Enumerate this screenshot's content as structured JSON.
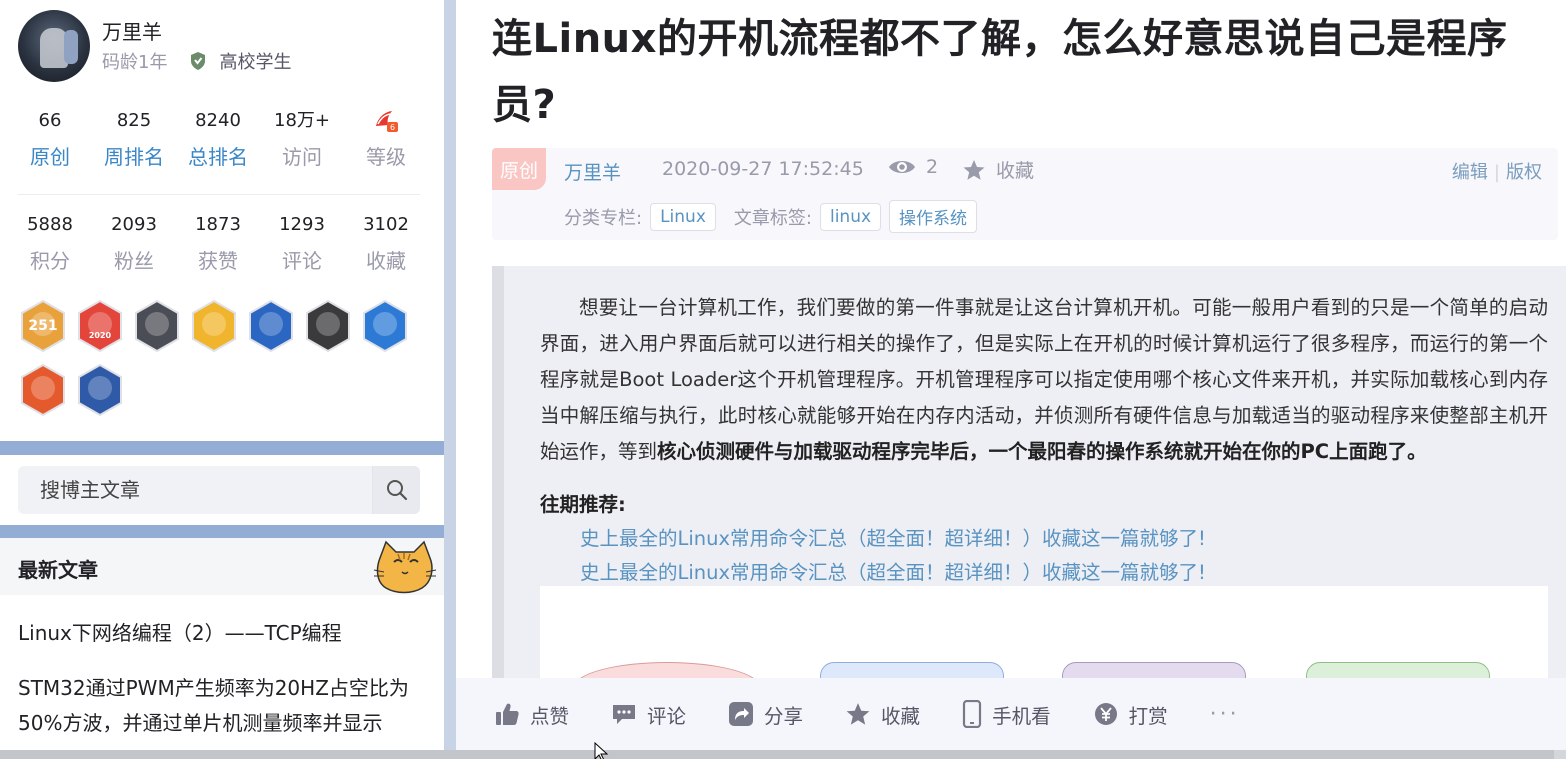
{
  "profile": {
    "name": "万里羊",
    "code_age": "码龄1年",
    "identity": "高校学生",
    "stats1": [
      {
        "value": "66",
        "label": "原创"
      },
      {
        "value": "825",
        "label": "周排名"
      },
      {
        "value": "8240",
        "label": "总排名"
      },
      {
        "value": "18万+",
        "label": "访问"
      },
      {
        "value": "",
        "label": "等级"
      }
    ],
    "stats2": [
      {
        "value": "5888",
        "label": "积分"
      },
      {
        "value": "2093",
        "label": "粉丝"
      },
      {
        "value": "1873",
        "label": "获赞"
      },
      {
        "value": "1293",
        "label": "评论"
      },
      {
        "value": "3102",
        "label": "收藏"
      }
    ],
    "badges": [
      {
        "text": "251",
        "color": "#e9a23b"
      },
      {
        "text": "2020",
        "color": "#e3453a"
      },
      {
        "text": "",
        "color": "#4a4d55"
      },
      {
        "text": "",
        "color": "#f0b42d"
      },
      {
        "text": "",
        "color": "#2a66c2"
      },
      {
        "text": "",
        "color": "#3a3a3c"
      },
      {
        "text": "",
        "color": "#2d7ad6"
      },
      {
        "text": "",
        "color": "#e55a2c"
      },
      {
        "text": "",
        "color": "#2f5aa8"
      }
    ]
  },
  "search": {
    "placeholder": "搜博主文章"
  },
  "latest": {
    "heading": "最新文章",
    "articles": [
      "Linux下网络编程（2）——TCP编程",
      "STM32通过PWM产生频率为20HZ占空比为50%方波，并通过单片机测量频率并显示"
    ]
  },
  "article": {
    "title": "连Linux的开机流程都不了解，怎么好意思说自己是程序员?",
    "type": "原创",
    "author": "万里羊",
    "date": "2020-09-27 17:52:45",
    "views": "2",
    "favorite": "收藏",
    "edit": "编辑",
    "copyright": "版权",
    "category_label": "分类专栏:",
    "category": "Linux",
    "tags_label": "文章标签:",
    "tags": [
      "linux",
      "操作系统"
    ],
    "para_normal": "想要让一台计算机工作，我们要做的第一件事就是让这台计算机开机。可能一般用户看到的只是一个简单的启动界面，进入用户界面后就可以进行相关的操作了，但是实际上在开机的时候计算机运行了很多程序，而运行的第一个程序就是Boot Loader这个开机管理程序。开机管理程序可以指定使用哪个核心文件来开机，并实际加载核心到内存当中解压缩与执行，此时核心就能够开始在内存内活动，并侦测所有硬件信息与加载适当的驱动程序来使整部主机开始运作，等到",
    "para_bold": "核心侦测硬件与加载驱动程序完毕后，一个最阳春的操作系统就开始在你的PC上面跑了。",
    "recommend_heading": "往期推荐:",
    "recommend": [
      "史上最全的Linux常用命令汇总（超全面！超详细！）收藏这一篇就够了!",
      "史上最全的Linux常用命令汇总（超全面！超详细！）收藏这一篇就够了!"
    ]
  },
  "toolbar": {
    "like": "点赞",
    "comment": "评论",
    "share": "分享",
    "favorite": "收藏",
    "mobile": "手机看",
    "reward": "打赏",
    "more": "···"
  }
}
